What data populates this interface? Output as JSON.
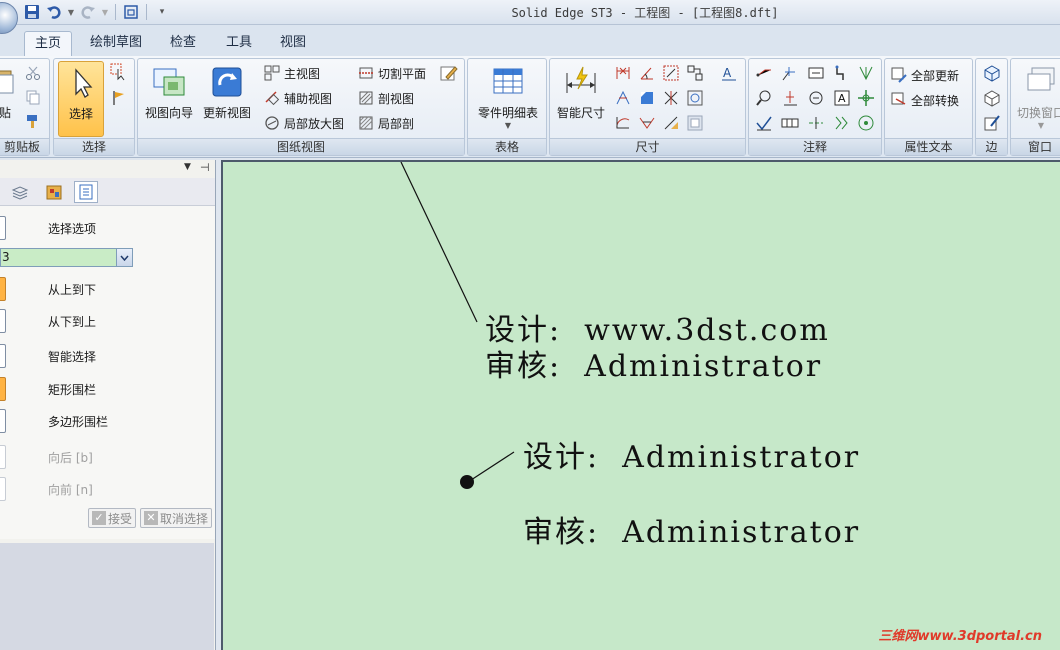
{
  "window": {
    "title": "Solid Edge ST3 - 工程图 - [工程图8.dft]"
  },
  "tabs": [
    "主页",
    "绘制草图",
    "检查",
    "工具",
    "视图"
  ],
  "ribbon": {
    "clipboard": {
      "paste_label": "贴",
      "group_label": "剪贴板"
    },
    "select": {
      "select_label": "选择",
      "group_label": "选择"
    },
    "drawing_views": {
      "view_wizard": "视图向导",
      "update_views": "更新视图",
      "items": [
        "主视图",
        "辅助视图",
        "局部放大图",
        "切割平面",
        "剖视图",
        "局部剖"
      ],
      "group_label": "图纸视图"
    },
    "tables": {
      "parts_list": "零件明细表",
      "group_label": "表格"
    },
    "dimensions": {
      "smart_dimension": "智能尺寸",
      "group_label": "尺寸"
    },
    "annotations": {
      "group_label": "注释"
    },
    "property_text": {
      "update_all": "全部更新",
      "convert_all": "全部转换",
      "group_label": "属性文本"
    },
    "edges": {
      "group_label": "边"
    },
    "window": {
      "switch_window": "切换窗口",
      "group_label": "窗口"
    }
  },
  "left_panel": {
    "rows": [
      "选择选项",
      "从上到下",
      "从下到上",
      "智能选择",
      "矩形围栏",
      "多边形围栏",
      "向后 [b]",
      "向前 [n]"
    ],
    "combo_value": "3",
    "accept": "接受",
    "deselect": "取消选择"
  },
  "canvas": {
    "block1": {
      "line1": "设计:  www.3dst.com",
      "line2": "审核:  Administrator"
    },
    "block2": {
      "line1": "设计:  Administrator",
      "line2": "审核:  Administrator"
    },
    "watermark": "三维网www.3dportal.cn"
  },
  "colors": {
    "canvas_bg": "#c6e8c9",
    "select_active": "#ffc24a",
    "watermark": "#e03a2a"
  }
}
